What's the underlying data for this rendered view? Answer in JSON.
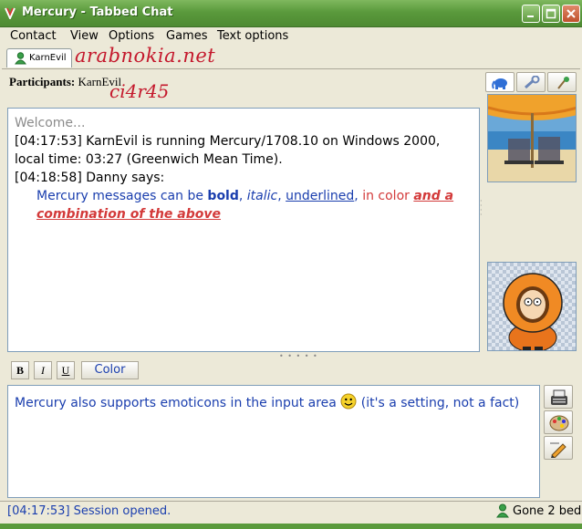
{
  "window": {
    "title": "Mercury - Tabbed Chat",
    "minimize_icon": "minimize-icon",
    "maximize_icon": "maximize-icon",
    "close_icon": "close-icon"
  },
  "menu": {
    "items": [
      "Contact",
      "View",
      "Options",
      "Games",
      "Text options"
    ]
  },
  "tab": {
    "label": "KarnEvil",
    "icon": "user-icon"
  },
  "watermarks": {
    "site": "arabnokia.net",
    "author": "ci4r45"
  },
  "participants": {
    "label": "Participants:",
    "names": "KarnEvil"
  },
  "chat": {
    "welcome": "Welcome...",
    "line1": "[04:17:53] KarnEvil is running Mercury/1708.10 on Windows 2000, local time: 03:27 (Greenwich Mean Time).",
    "line2": "[04:18:58] Danny says:",
    "msg_prefix": "Mercury messages can be ",
    "msg_bold": "bold",
    "msg_comma1": ", ",
    "msg_italic": "italic",
    "msg_comma2": ", ",
    "msg_underline": "underlined",
    "msg_comma3": ", ",
    "msg_color": "in color",
    "msg_space": " ",
    "msg_combo": "and a combination of the above"
  },
  "format": {
    "bold": "B",
    "italic": "I",
    "underline": "U",
    "color": "Color"
  },
  "input": {
    "text_before": "Mercury also supports emoticons in the input area ",
    "text_after": " (it's a setting, not a fact)"
  },
  "status": {
    "left": "[04:17:53] Session opened.",
    "right": "Gone 2 bed"
  },
  "colors": {
    "link_blue": "#1a3eae",
    "red": "#d33a3a",
    "titlebar": "#5a9a3c"
  }
}
